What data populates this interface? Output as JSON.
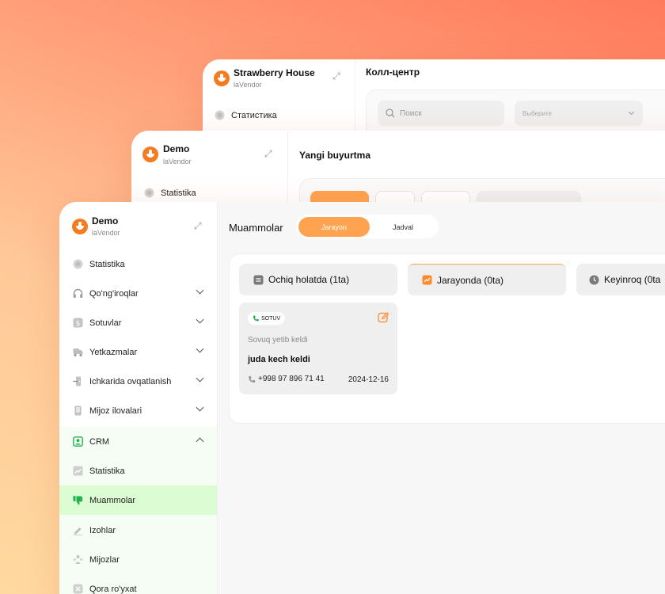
{
  "back_window": {
    "brand": "Strawberry House",
    "sub": "laVendor",
    "title": "Колл-центр",
    "nav_item": "Статистика",
    "search_placeholder": "Поиск",
    "select_placeholder": "Выберите"
  },
  "mid_window": {
    "brand": "Demo",
    "sub": "laVendor",
    "title": "Yangi buyurtma",
    "nav_item": "Statistika"
  },
  "front_window": {
    "brand": "Demo",
    "sub": "laVendor",
    "page_title": "Muammolar",
    "view_tabs": [
      "Jarayon",
      "Jadval"
    ],
    "sidebar": [
      {
        "label": "Statistika",
        "icon": "chart-circle-icon"
      },
      {
        "label": "Qo'ng'iroqlar",
        "icon": "headphones-icon"
      },
      {
        "label": "Sotuvlar",
        "icon": "dollar-icon"
      },
      {
        "label": "Yetkazmalar",
        "icon": "truck-icon"
      },
      {
        "label": "Ichkarida ovqatlanish",
        "icon": "door-icon"
      },
      {
        "label": "Mijoz ilovalari",
        "icon": "phone-icon"
      },
      {
        "label": "CRM",
        "icon": "user-card-icon"
      },
      {
        "label": "Statistika",
        "icon": "bar-chart-icon"
      },
      {
        "label": "Muammolar",
        "icon": "thumbs-down-icon"
      },
      {
        "label": "Izohlar",
        "icon": "pencil-icon"
      },
      {
        "label": "Mijozlar",
        "icon": "users-icon"
      },
      {
        "label": "Qora ro'yxat",
        "icon": "block-icon"
      }
    ],
    "columns": [
      {
        "label": "Ochiq holatda (1ta)",
        "icon": "list-icon"
      },
      {
        "label": "Jarayonda (0ta)",
        "icon": "trend-icon"
      },
      {
        "label": "Keyinroq (0ta",
        "icon": "clock-icon"
      }
    ],
    "card": {
      "tag": "SOTUV",
      "subtitle": "Sovuq yetib keldi",
      "title": "juda kech keldi",
      "phone": "+998 97 896 71 41",
      "date": "2024-12-16"
    }
  },
  "colors": {
    "accent": "#ffa350",
    "active_nav_bg": "#dcfcd4",
    "crm_green": "#22b14c",
    "brand_orange": "#f47b20"
  }
}
